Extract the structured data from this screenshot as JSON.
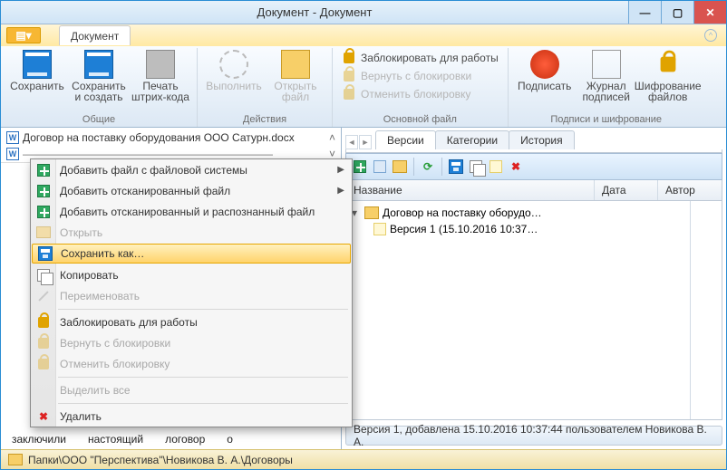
{
  "window": {
    "title": "Документ - Документ"
  },
  "doc_tab": "Документ",
  "ribbon": {
    "groups": {
      "common": {
        "label": "Общие",
        "save": "Сохранить",
        "save_create": "Сохранить\nи создать",
        "barcode": "Печать\nштрих-кода"
      },
      "actions": {
        "label": "Действия",
        "execute": "Выполнить",
        "open_file": "Открыть\nфайл"
      },
      "main_file": {
        "label": "Основной файл",
        "lock": "Заблокировать для работы",
        "unlock": "Вернуть с блокировки",
        "cancel_lock": "Отменить блокировку"
      },
      "sign": {
        "label": "Подписи и шифрование",
        "sign": "Подписать",
        "journal": "Журнал\nподписей",
        "encrypt": "Шифрование\nфайлов"
      }
    }
  },
  "left_files": [
    "Договор на поставку оборудования ООО Сатурн.docx"
  ],
  "context_menu": {
    "add_fs": "Добавить файл с файловой системы",
    "add_scan": "Добавить отсканированный файл",
    "add_scan_ocr": "Добавить отсканированный и распознанный файл",
    "open": "Открыть",
    "save_as": "Сохранить как…",
    "copy": "Копировать",
    "rename": "Переименовать",
    "lock": "Заблокировать для работы",
    "unlock": "Вернуть с блокировки",
    "cancel_lock": "Отменить блокировку",
    "select_all": "Выделить все",
    "delete": "Удалить"
  },
  "right": {
    "tabs": {
      "versions": "Версии",
      "categories": "Категории",
      "history": "История"
    },
    "columns": {
      "name": "Название",
      "date": "Дата",
      "author": "Автор"
    },
    "tree": {
      "root": "Договор на поставку оборудо…",
      "child": "Версия 1 (15.10.2016 10:37…"
    },
    "status": "Версия 1, добавлена 15.10.2016 10:37:44 пользователем Новикова В. А."
  },
  "bottom_doc_words": [
    "заключили",
    "настоящий",
    "логовор",
    "о"
  ],
  "breadcrumb": "Папки\\ООО \"Перспектива\"\\Новикова В. А.\\Договоры"
}
